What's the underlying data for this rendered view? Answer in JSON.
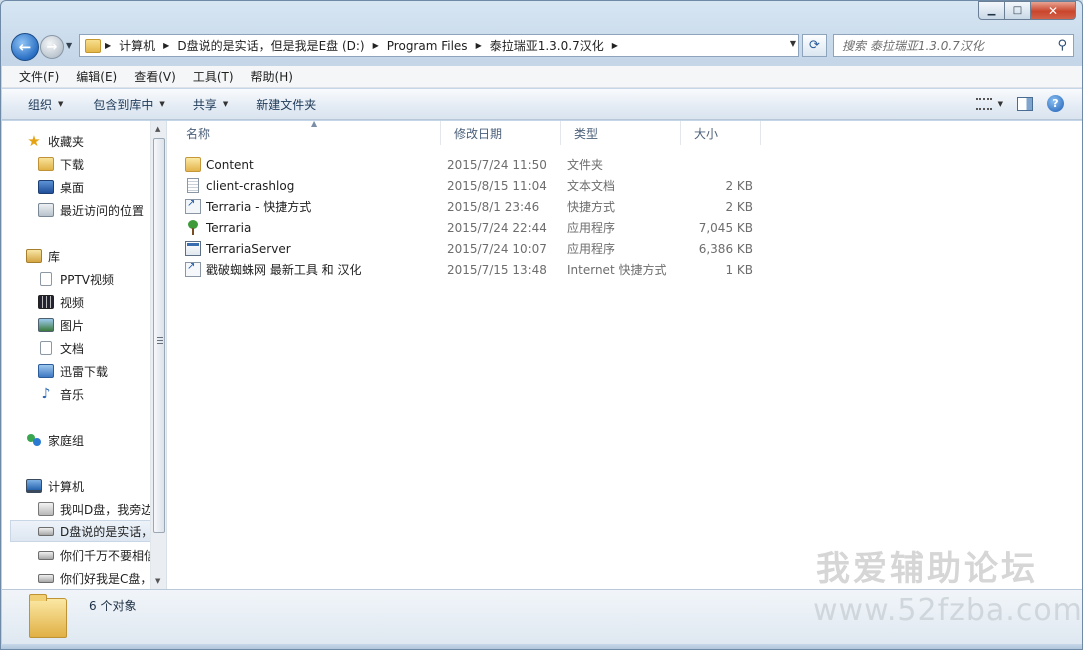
{
  "window": {
    "minimize": "▁",
    "maximize": "□",
    "close": "✕"
  },
  "nav": {
    "back": "←",
    "forward": "→",
    "breadcrumbs": [
      "计算机",
      "D盘说的是实话，但是我是E盘 (D:)",
      "Program Files",
      "泰拉瑞亚1.3.0.7汉化"
    ],
    "search_placeholder": "搜索 泰拉瑞亚1.3.0.7汉化"
  },
  "menu": [
    "文件(F)",
    "编辑(E)",
    "查看(V)",
    "工具(T)",
    "帮助(H)"
  ],
  "toolbar": {
    "organize": "组织",
    "include_library": "包含到库中",
    "share": "共享",
    "new_folder": "新建文件夹"
  },
  "sidebar": {
    "favorites": {
      "label": "收藏夹",
      "items": [
        "下载",
        "桌面",
        "最近访问的位置"
      ]
    },
    "libraries": {
      "label": "库",
      "items": [
        "PPTV视频",
        "视频",
        "图片",
        "文档",
        "迅雷下载",
        "音乐"
      ]
    },
    "homegroup": "家庭组",
    "computer": {
      "label": "计算机",
      "items": [
        "我叫D盘，我旁边",
        "D盘说的是实话，",
        "你们千万不要相信",
        "你们好我是C盘，"
      ]
    }
  },
  "columns": {
    "name": "名称",
    "modified": "修改日期",
    "type": "类型",
    "size": "大小"
  },
  "files": [
    {
      "name": "Content",
      "modified": "2015/7/24 11:50",
      "type": "文件夹",
      "size": "",
      "icon": "folder-icon"
    },
    {
      "name": "client-crashlog",
      "modified": "2015/8/15 11:04",
      "type": "文本文档",
      "size": "2 KB",
      "icon": "text-file-icon"
    },
    {
      "name": "Terraria - 快捷方式",
      "modified": "2015/8/1 23:46",
      "type": "快捷方式",
      "size": "2 KB",
      "icon": "shortcut-icon"
    },
    {
      "name": "Terraria",
      "modified": "2015/7/24 22:44",
      "type": "应用程序",
      "size": "7,045 KB",
      "icon": "terraria-tree-icon"
    },
    {
      "name": "TerrariaServer",
      "modified": "2015/7/24 10:07",
      "type": "应用程序",
      "size": "6,386 KB",
      "icon": "application-icon"
    },
    {
      "name": "戳破蜘蛛网 最新工具 和 汉化",
      "modified": "2015/7/15 13:48",
      "type": "Internet 快捷方式",
      "size": "1 KB",
      "icon": "internet-shortcut-icon"
    }
  ],
  "status": {
    "count": "6 个对象"
  },
  "watermark": {
    "title": "我爱辅助论坛",
    "url": "www.52fzba.com"
  }
}
